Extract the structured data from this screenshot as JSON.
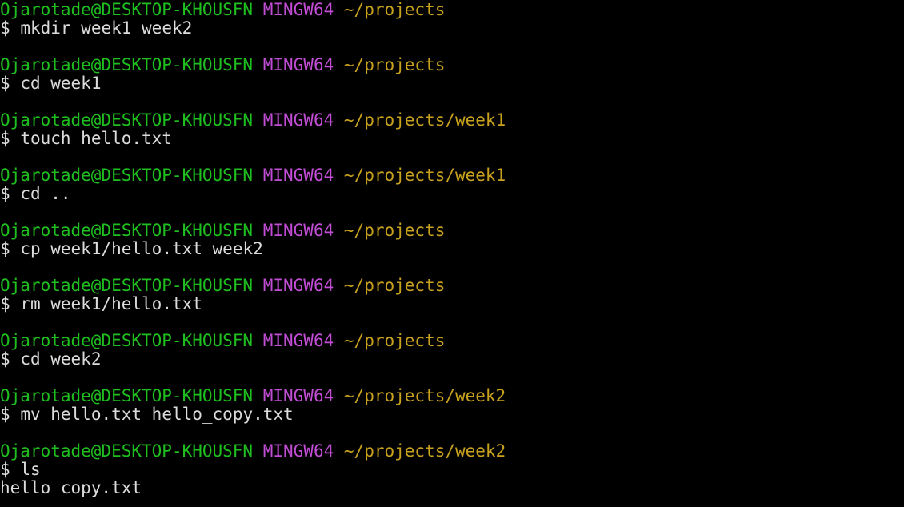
{
  "prompt": {
    "user_host": "Ojarotade@DESKTOP-KHOUSFN",
    "system": "MINGW64",
    "symbol": "$"
  },
  "entries": [
    {
      "path": "~/projects",
      "command": "mkdir week1 week2",
      "output": []
    },
    {
      "path": "~/projects",
      "command": "cd week1",
      "output": []
    },
    {
      "path": "~/projects/week1",
      "command": "touch hello.txt",
      "output": []
    },
    {
      "path": "~/projects/week1",
      "command": "cd ..",
      "output": []
    },
    {
      "path": "~/projects",
      "command": "cp week1/hello.txt week2",
      "output": []
    },
    {
      "path": "~/projects",
      "command": "rm week1/hello.txt",
      "output": []
    },
    {
      "path": "~/projects",
      "command": "cd week2",
      "output": []
    },
    {
      "path": "~/projects/week2",
      "command": "mv hello.txt hello_copy.txt",
      "output": []
    },
    {
      "path": "~/projects/week2",
      "command": "ls",
      "output": [
        "hello_copy.txt"
      ]
    }
  ],
  "colors": {
    "background": "#000000",
    "user_host": "#1fbf1f",
    "system": "#c04dd4",
    "path": "#c8a21e",
    "text": "#dcdcdc"
  }
}
